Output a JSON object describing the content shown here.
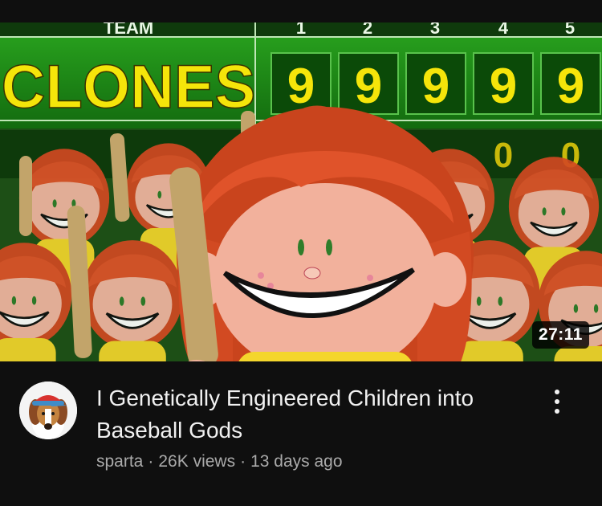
{
  "video": {
    "thumbnail": {
      "team_header": "TEAM",
      "inning_numbers": [
        "1",
        "2",
        "3",
        "4",
        "5"
      ],
      "team_name": "CLONES",
      "scores": [
        "9",
        "9",
        "9",
        "9",
        "9"
      ],
      "second_row_scores": [
        "0",
        "0"
      ]
    },
    "duration": "27:11",
    "title": "I Genetically Engineered Children into Baseball Gods",
    "channel": "sparta",
    "views": "26K views",
    "age": "13 days ago",
    "separator": "·"
  },
  "icons": {
    "menu": "more-vertical-icon",
    "avatar": "beagle-with-cap-avatar"
  },
  "colors": {
    "background": "#0f0f0f",
    "title": "#f1f1f1",
    "secondary_text": "#aaaaaa",
    "scoreboard_green": "#1e8c16",
    "score_yellow": "#f5e50a",
    "hair_orange": "#e0532a"
  }
}
